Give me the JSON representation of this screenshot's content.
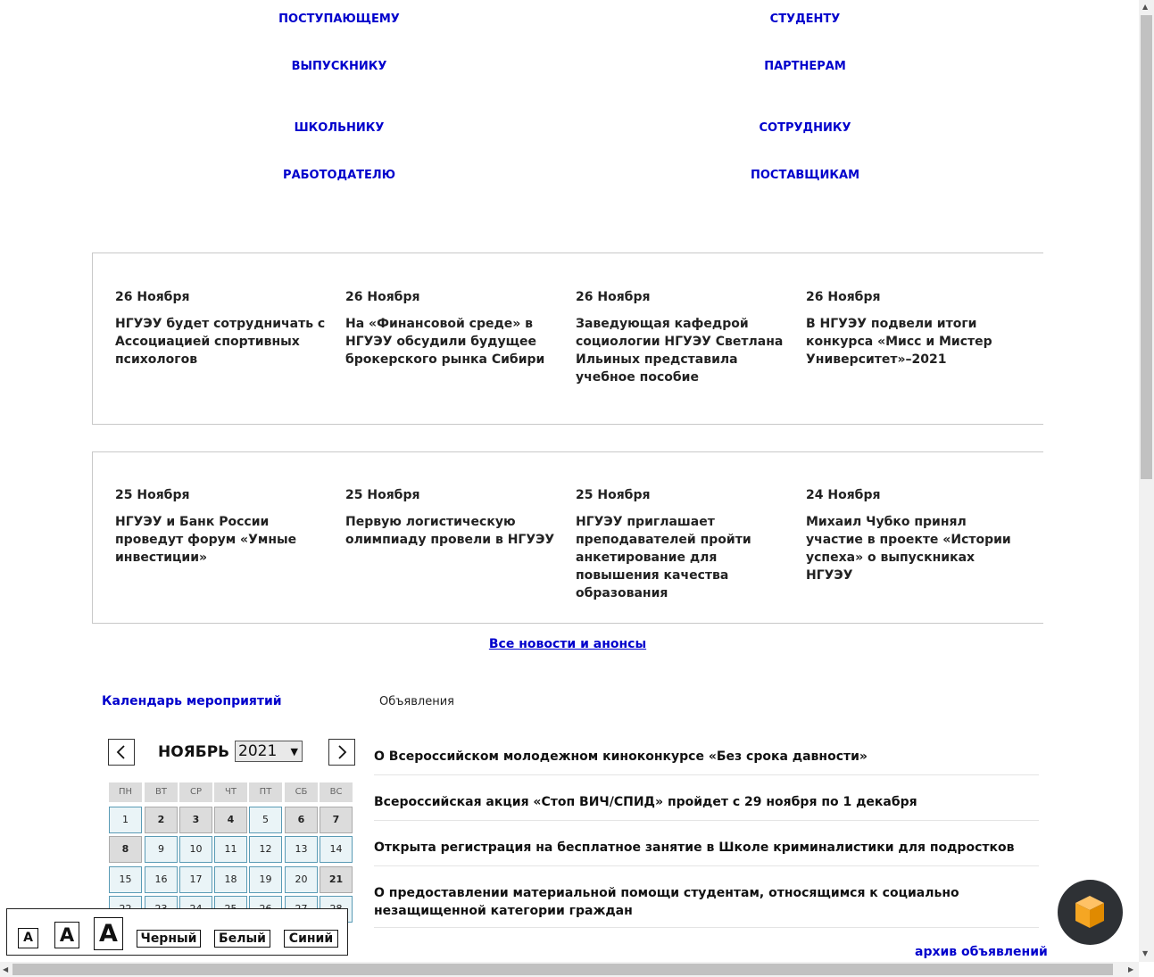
{
  "nav": {
    "entrant": "ПОСТУПАЮЩЕМУ",
    "student": "СТУДЕНТУ",
    "graduate": "ВЫПУСКНИКУ",
    "partners": "ПАРТНЕРАМ",
    "schoolkid": "ШКОЛЬНИКУ",
    "employee": "СОТРУДНИКУ",
    "employer": "РАБОТОДАТЕЛЮ",
    "suppliers": "ПОСТАВЩИКАМ"
  },
  "news": [
    {
      "date": "26 Ноября",
      "title": "НГУЭУ будет сотрудничать с Ассоциацией спортивных психологов"
    },
    {
      "date": "26 Ноября",
      "title": "На «Финансовой среде» в НГУЭУ обсудили будущее брокерского рынка Сибири"
    },
    {
      "date": "26 Ноября",
      "title": "Заведующая кафедрой социологии НГУЭУ Светлана Ильиных представила учебное пособие"
    },
    {
      "date": "26 Ноября",
      "title": "В НГУЭУ подвели итоги конкурса «Мисс и Мистер Университет»–2021"
    },
    {
      "date": "25 Ноября",
      "title": "НГУЭУ и Банк России проведут форум «Умные инвестиции»"
    },
    {
      "date": "25 Ноября",
      "title": "Первую логистическую олимпиаду провели в НГУЭУ"
    },
    {
      "date": "25 Ноября",
      "title": "НГУЭУ приглашает преподавателей пройти анкетирование для повышения качества образования"
    },
    {
      "date": "24 Ноября",
      "title": "Михаил Чубко принял участие в проекте «Истории успеха» о выпускниках НГУЭУ"
    }
  ],
  "all_news_link": "Все новости и анонсы",
  "tabs": {
    "calendar": "Календарь мероприятий",
    "announcements": "Объявления"
  },
  "calendar": {
    "month": "НОЯБРЬ",
    "year": "2021",
    "weekdays": [
      "ПН",
      "ВТ",
      "СР",
      "ЧТ",
      "ПТ",
      "СБ",
      "ВС"
    ],
    "days": [
      "1",
      "2",
      "3",
      "4",
      "5",
      "6",
      "7",
      "8",
      "9",
      "10",
      "11",
      "12",
      "13",
      "14",
      "15",
      "16",
      "17",
      "18",
      "19",
      "20",
      "21",
      "22",
      "23",
      "24",
      "25",
      "26",
      "27",
      "28"
    ],
    "highlighted_days": [
      "2",
      "3",
      "4",
      "6",
      "7",
      "8",
      "21"
    ]
  },
  "announcements": [
    "О Всероссийском молодежном киноконкурсе «Без срока давности»",
    "Всероссийская акция «Стоп ВИЧ/СПИД» пройдет с 29 ноября по 1 декабря",
    "Открыта регистрация на бесплатное занятие в Школе криминалистики для подростков",
    "О предоставлении материальной помощи студентам, относящимся к социально незащищенной категории граждан"
  ],
  "archive_link": "архив объявлений",
  "accessibility": {
    "font_small": "A",
    "font_medium": "A",
    "font_large": "A",
    "theme_black": "Черный",
    "theme_white": "Белый",
    "theme_blue": "Синий"
  },
  "icons": {
    "prev": "chevron-left-icon",
    "next": "chevron-right-icon",
    "chat": "chat-cube-icon"
  },
  "colors": {
    "link": "#0000cc",
    "chat_cube": "#f5a623"
  }
}
